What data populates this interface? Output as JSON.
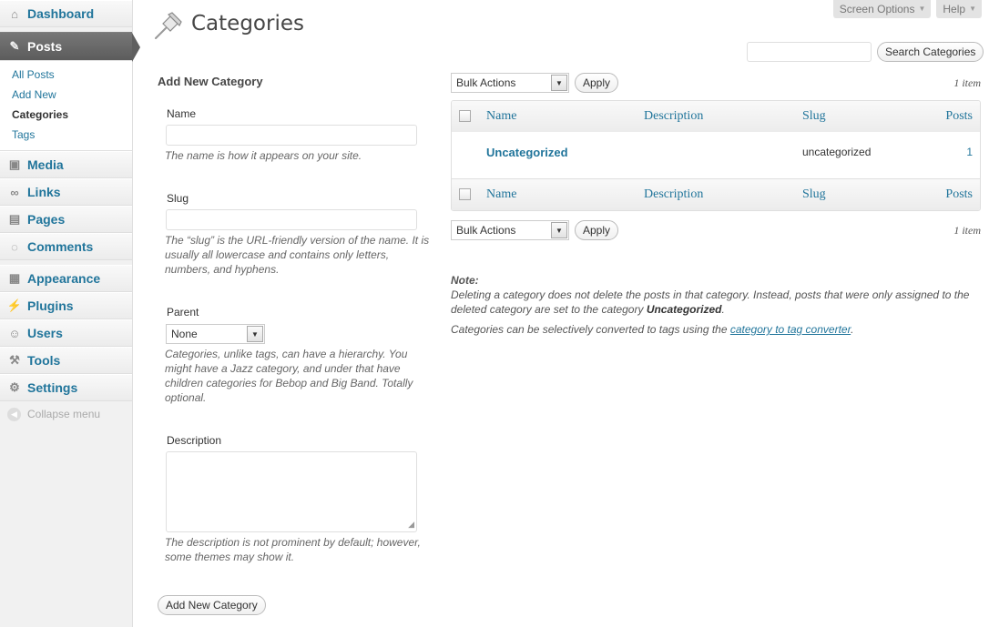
{
  "sidebar": {
    "dashboard": "Dashboard",
    "posts": "Posts",
    "posts_sub": [
      "All Posts",
      "Add New",
      "Categories",
      "Tags"
    ],
    "media": "Media",
    "links": "Links",
    "pages": "Pages",
    "comments": "Comments",
    "appearance": "Appearance",
    "plugins": "Plugins",
    "users": "Users",
    "tools": "Tools",
    "settings": "Settings",
    "collapse": "Collapse menu"
  },
  "header": {
    "title": "Categories",
    "screen_options": "Screen Options",
    "help": "Help"
  },
  "search": {
    "value": "",
    "button": "Search Categories"
  },
  "form": {
    "title": "Add New Category",
    "name_label": "Name",
    "name_value": "",
    "name_desc": "The name is how it appears on your site.",
    "slug_label": "Slug",
    "slug_value": "",
    "slug_desc": "The “slug” is the URL-friendly version of the name. It is usually all lowercase and contains only letters, numbers, and hyphens.",
    "parent_label": "Parent",
    "parent_value": "None",
    "parent_desc": "Categories, unlike tags, can have a hierarchy. You might have a Jazz category, and under that have children categories for Bebop and Big Band. Totally optional.",
    "description_label": "Description",
    "description_value": "",
    "description_desc": "The description is not prominent by default; however, some themes may show it.",
    "submit": "Add New Category"
  },
  "table": {
    "bulk_actions": "Bulk Actions",
    "apply": "Apply",
    "count": "1 item",
    "columns": [
      "Name",
      "Description",
      "Slug",
      "Posts"
    ],
    "rows": [
      {
        "name": "Uncategorized",
        "description": "",
        "slug": "uncategorized",
        "posts": "1"
      }
    ]
  },
  "note": {
    "label": "Note:",
    "line1_a": "Deleting a category does not delete the posts in that category. Instead, posts that were only assigned to the deleted category are set to the category ",
    "line1_b": "Uncategorized",
    "line1_c": ".",
    "line2_a": "Categories can be selectively converted to tags using the ",
    "line2_link": "category to tag converter",
    "line2_c": "."
  },
  "icons": {
    "dashboard": "home-icon",
    "posts": "pushpin-icon",
    "media": "media-icon",
    "links": "link-icon",
    "pages": "pages-icon",
    "comments": "comment-icon",
    "appearance": "appearance-icon",
    "plugins": "plug-icon",
    "users": "users-icon",
    "tools": "tools-icon",
    "settings": "settings-icon"
  },
  "colors": {
    "link": "#21759b",
    "current_menu": "#5f5f5f",
    "sidebar_bg": "#f1f1f1"
  }
}
